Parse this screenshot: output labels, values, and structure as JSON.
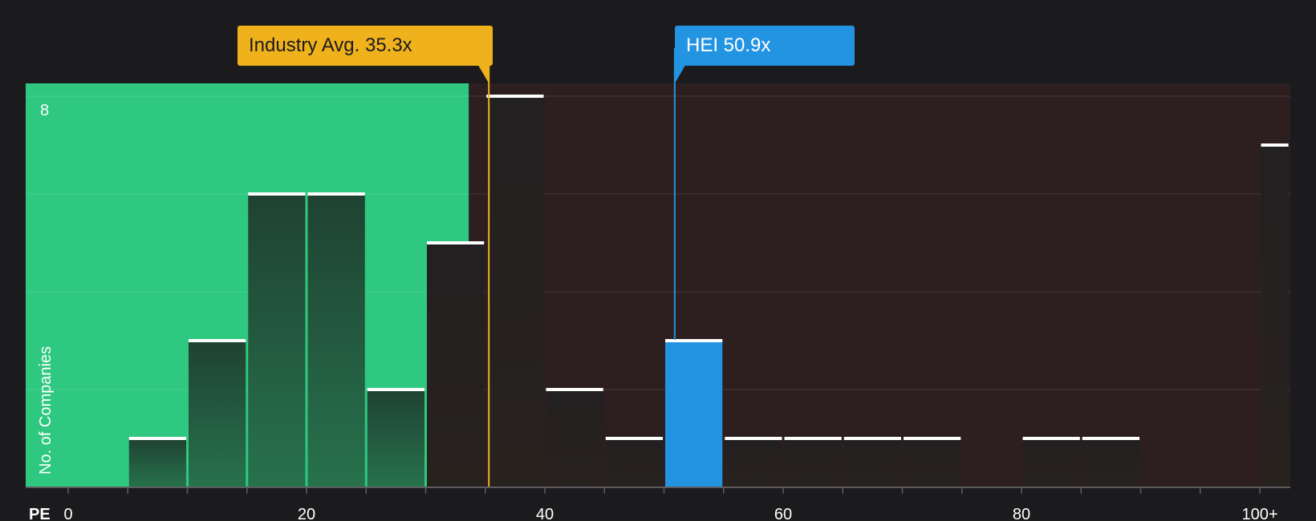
{
  "chart_data": {
    "type": "bar",
    "x_axis_label": "PE",
    "y_axis_label": "No. of Companies",
    "x_ticks": [
      "0",
      "20",
      "40",
      "60",
      "80",
      "100+"
    ],
    "y_tick_shown": "8",
    "ylim": [
      0,
      8.3
    ],
    "bin_width": 5,
    "bars": [
      {
        "x_start": 5,
        "x_end": 10,
        "count": 1
      },
      {
        "x_start": 10,
        "x_end": 15,
        "count": 3
      },
      {
        "x_start": 15,
        "x_end": 20,
        "count": 6
      },
      {
        "x_start": 20,
        "x_end": 25,
        "count": 6
      },
      {
        "x_start": 25,
        "x_end": 30,
        "count": 2
      },
      {
        "x_start": 30,
        "x_end": 35,
        "count": 5
      },
      {
        "x_start": 35,
        "x_end": 40,
        "count": 8
      },
      {
        "x_start": 40,
        "x_end": 45,
        "count": 2
      },
      {
        "x_start": 45,
        "x_end": 50,
        "count": 1
      },
      {
        "x_start": 50,
        "x_end": 55,
        "count": 3,
        "highlight": true
      },
      {
        "x_start": 55,
        "x_end": 60,
        "count": 1
      },
      {
        "x_start": 60,
        "x_end": 65,
        "count": 1
      },
      {
        "x_start": 65,
        "x_end": 70,
        "count": 1
      },
      {
        "x_start": 70,
        "x_end": 75,
        "count": 1
      },
      {
        "x_start": 80,
        "x_end": 85,
        "count": 1
      },
      {
        "x_start": 85,
        "x_end": 90,
        "count": 1
      },
      {
        "x_start": 100,
        "x_end": 102.5,
        "count": 7
      }
    ],
    "industry_avg": {
      "label": "Industry Avg. 35.3x",
      "value": 35.3
    },
    "company": {
      "label": "HEI 50.9x",
      "value": 50.9
    },
    "colors": {
      "background": "#1b1b1d",
      "undervalued_zone": "#2ec880",
      "overvalued_zone": "#2d1e20",
      "industry": "#efb21c",
      "company": "#2394e2"
    }
  }
}
